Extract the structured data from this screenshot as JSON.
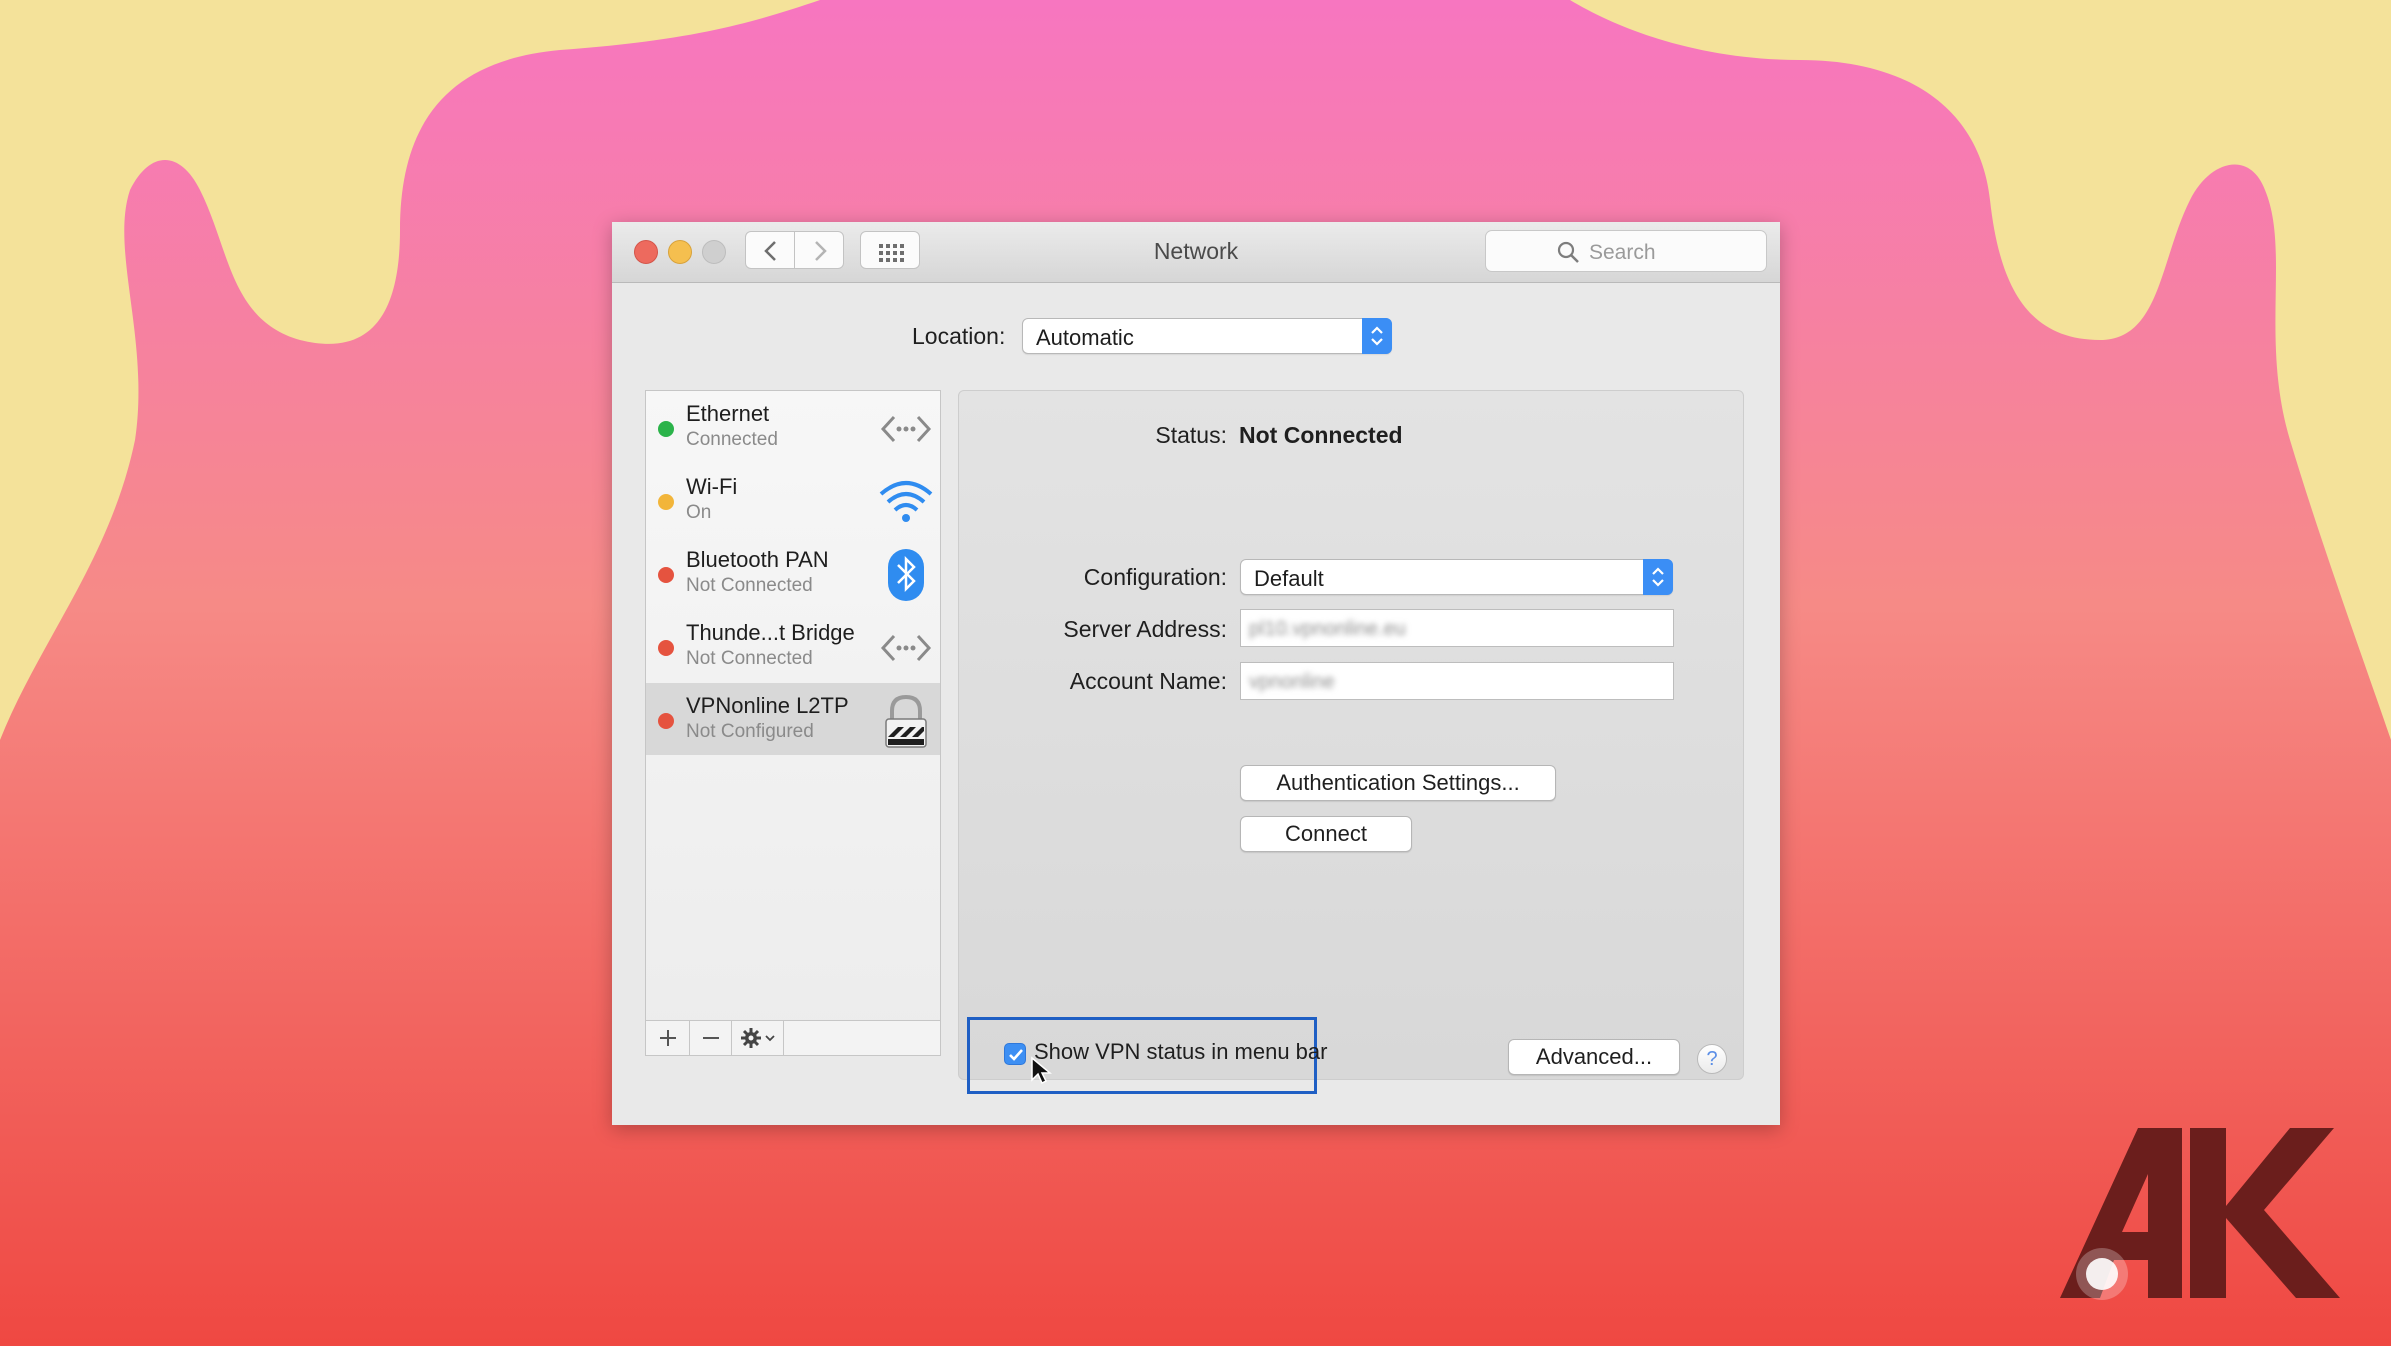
{
  "window": {
    "title": "Network",
    "search_placeholder": "Search"
  },
  "location": {
    "label": "Location:",
    "value": "Automatic"
  },
  "services": [
    {
      "name": "Ethernet",
      "status": "Connected",
      "dot_color": "#2bb34a",
      "icon": "ethernet-icon"
    },
    {
      "name": "Wi-Fi",
      "status": "On",
      "dot_color": "#f2b53a",
      "icon": "wifi-icon"
    },
    {
      "name": "Bluetooth PAN",
      "status": "Not Connected",
      "dot_color": "#e5533f",
      "icon": "bluetooth-icon"
    },
    {
      "name": "Thunde...t Bridge",
      "status": "Not Connected",
      "dot_color": "#e5533f",
      "icon": "thunderbolt-bridge-icon"
    },
    {
      "name": "VPNonline L2TP",
      "status": "Not Configured",
      "dot_color": "#e5533f",
      "icon": "vpn-lock-icon",
      "selected": true
    }
  ],
  "sidebar_toolbar": {
    "add": "+",
    "remove": "−"
  },
  "detail": {
    "status_label": "Status:",
    "status_value": "Not Connected",
    "configuration_label": "Configuration:",
    "configuration_value": "Default",
    "server_address_label": "Server Address:",
    "server_address_value": "pl10.vpnonline.eu",
    "account_name_label": "Account Name:",
    "account_name_value": "vpnonline",
    "auth_button": "Authentication Settings...",
    "connect_button": "Connect",
    "show_vpn_status_label": "Show VPN status in menu bar",
    "show_vpn_status_checked": true,
    "advanced_button": "Advanced...",
    "help_button": "?"
  },
  "colors": {
    "accent": "#3b8ef5",
    "highlight_border": "#1f5fc4",
    "background_yellow": "#f4e29a",
    "background_pink": "#f776c0",
    "background_red": "#ef4842",
    "logo": "#6b1e1c"
  }
}
